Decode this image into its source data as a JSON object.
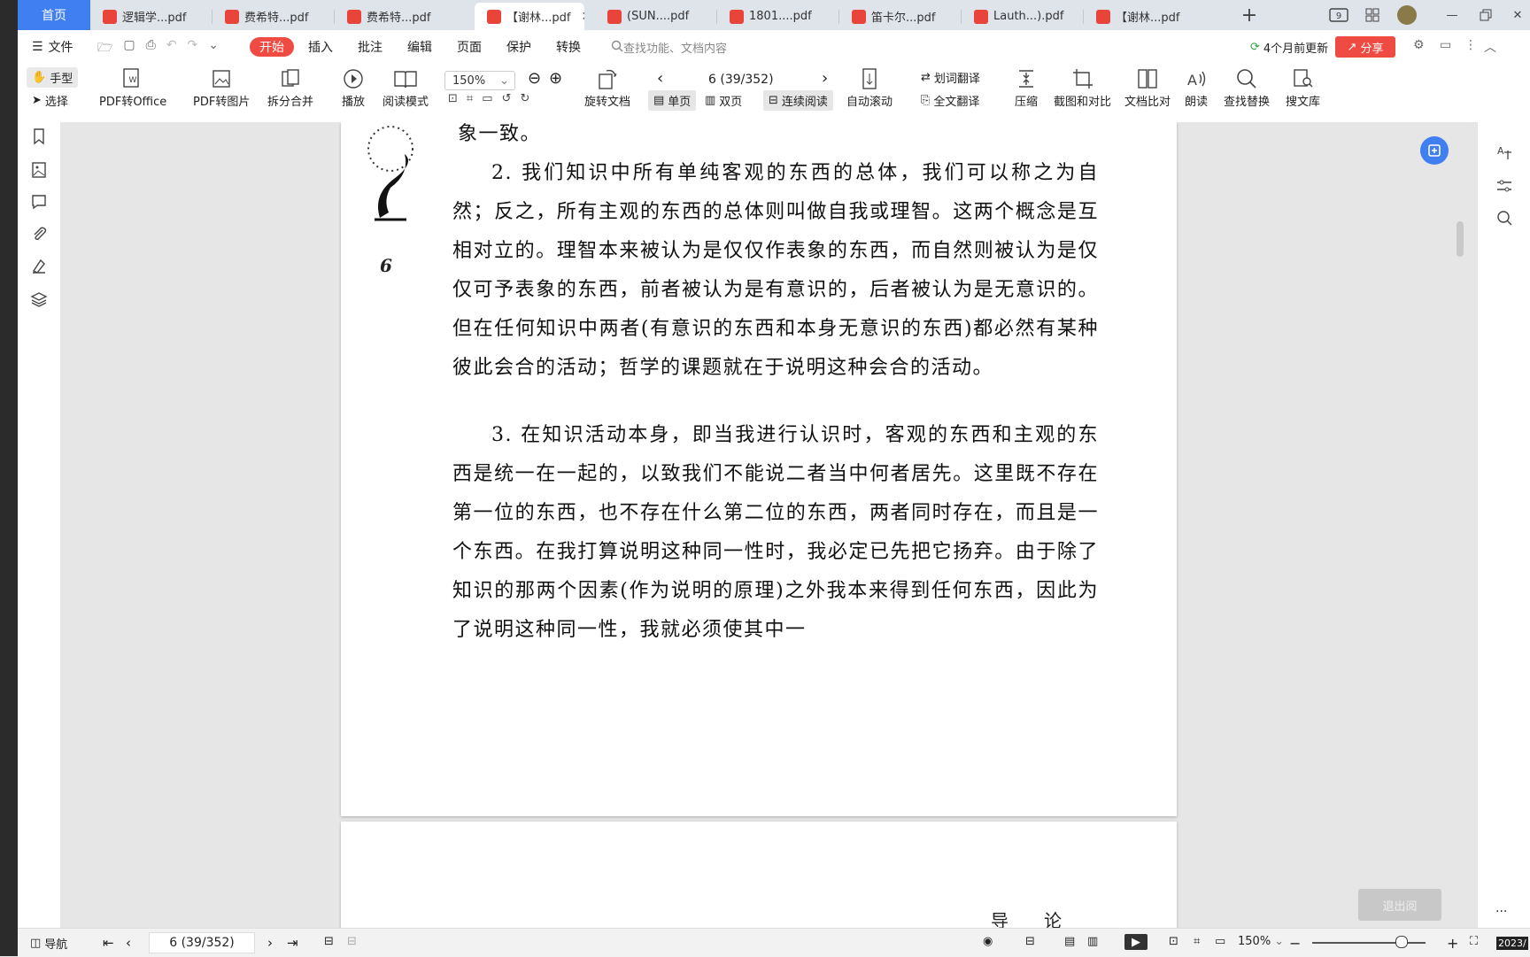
{
  "tabs": {
    "home": "首页",
    "items": [
      {
        "label": "逻辑学...pdf",
        "active": false
      },
      {
        "label": "费希特...pdf",
        "active": false
      },
      {
        "label": "费希特...pdf",
        "active": false
      },
      {
        "label": "【谢林...pdf",
        "active": true
      },
      {
        "label": "(SUN....pdf",
        "active": false
      },
      {
        "label": "1801....pdf",
        "active": false
      },
      {
        "label": "笛卡尔...pdf",
        "active": false
      },
      {
        "label": "Lauth...).pdf",
        "active": false
      },
      {
        "label": "【谢林...pdf",
        "active": false
      }
    ]
  },
  "menu": {
    "file": "文件",
    "items": [
      "开始",
      "插入",
      "批注",
      "编辑",
      "页面",
      "保护",
      "转换"
    ],
    "search_placeholder": "查找功能、文档内容",
    "update": "4个月前更新",
    "share": "分享"
  },
  "toolbar": {
    "hand": "手型",
    "select": "选择",
    "pdf_to_office": "PDF转Office",
    "pdf_to_image": "PDF转图片",
    "split_merge": "拆分合并",
    "play": "播放",
    "read_mode": "阅读模式",
    "zoom": "150%",
    "rotate": "旋转文档",
    "page_indicator": "6 (39/352)",
    "single": "单页",
    "double": "双页",
    "continuous": "连续阅读",
    "auto_scroll": "自动滚动",
    "word_translate": "划词翻译",
    "full_translate": "全文翻译",
    "compress": "压缩",
    "screenshot_compare": "截图和对比",
    "doc_compare": "文档比对",
    "read_aloud": "朗读",
    "find_replace": "查找替换",
    "search_lib": "搜文库"
  },
  "document": {
    "page_number": "6",
    "line_top": "象一致。",
    "para2": "2. 我们知识中所有单纯客观的东西的总体，我们可以称之为自然；反之，所有主观的东西的总体则叫做自我或理智。这两个概念是互相对立的。理智本来被认为是仅仅作表象的东西，而自然则被认为是仅仅可予表象的东西，前者被认为是有意识的，后者被认为是无意识的。但在任何知识中两者(有意识的东西和本身无意识的东西)都必然有某种彼此会合的活动；哲学的课题就在于说明这种会合的活动。",
    "para3": "3. 在知识活动本身，即当我进行认识时，客观的东西和主观的东西是统一在一起的，以致我们不能说二者当中何者居先。这里既不存在第一位的东西，也不存在什么第二位的东西，两者同时存在，而且是一个东西。在我打算说明这种同一性时，我必定已先把它扬弃。由于除了知识的那两个因素(作为说明的原理)之外我本来得到任何东西，因此为了说明这种同一性，我就必须使其中一",
    "next_page_header": "导论"
  },
  "exit_button": "退出阅",
  "statusbar": {
    "nav": "导航",
    "page": "6 (39/352)",
    "zoom": "150%",
    "clock": "2023/"
  },
  "colors": {
    "accent_blue": "#3f7ff2",
    "accent_red": "#ef4b43"
  }
}
